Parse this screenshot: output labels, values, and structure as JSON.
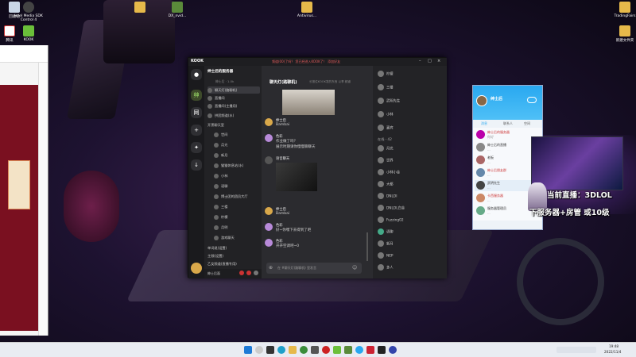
{
  "desktop_icons": [
    {
      "label": "回收站"
    },
    {
      "label": "Intel Media SDK Control 4"
    },
    {
      "label": "DX_nvid..."
    },
    {
      "label": "Antivirus..."
    },
    {
      "label": "TradingFairs"
    },
    {
      "label": "腾讯"
    },
    {
      "label": "KOOK"
    },
    {
      "label": "新建文件夹"
    }
  ],
  "kook": {
    "logo": "KOOK",
    "announcement": "频道(00)了吗？ 您已经进入KOOK了！ 添加好友",
    "server_name": "绅士后的服务器",
    "user_hint": "绅士后 · 1.0k",
    "channels": [
      {
        "label": "聊天灯(路聊机)"
      },
      {
        "label": "直播间"
      },
      {
        "label": "直播间(主播用)"
      },
      {
        "label": "拼团频道(水)"
      },
      {
        "label": "开黑聊天室"
      },
      {
        "label": "世间"
      },
      {
        "label": "月光"
      },
      {
        "label": "新月"
      },
      {
        "label": "猫猫休息站(水)"
      },
      {
        "label": "小林"
      },
      {
        "label": "语聊"
      },
      {
        "label": "博士团的团员大厅"
      },
      {
        "label": "三楼"
      },
      {
        "label": "柠檬"
      },
      {
        "label": "月明"
      },
      {
        "label": "游戏聊天"
      },
      {
        "label": "单词说(设置)"
      },
      {
        "label": "主频(设置)"
      },
      {
        "label": "乙女频道(直播专用)"
      }
    ],
    "footer_user": "绅士后面",
    "chat_title": "聊天灯(路聊机)",
    "chat_subtitle": "长按住KOOK发的东西 以享 频道",
    "messages": [
      {
        "name": "绅士后",
        "text": "Bambai"
      },
      {
        "name": "色彩",
        "text": "作业做了吗？"
      },
      {
        "name": "",
        "text": "展示时期请你慢慢聊聊天"
      },
      {
        "name": "语音聊天",
        "text": ""
      },
      {
        "name": "绅士后",
        "text": "Bambai"
      },
      {
        "name": "色彩",
        "text": "好~你嘿下去得到了吧"
      },
      {
        "name": "色彩",
        "text": "开开空调吧~0"
      }
    ],
    "input_placeholder": "在 #聊天灯(路聊机) 里发言",
    "members_header": "在线 - 42",
    "members": [
      {
        "name": "柠檬"
      },
      {
        "name": "三楼"
      },
      {
        "name": "武明先生"
      },
      {
        "name": "小林"
      },
      {
        "name": "嘉宾"
      },
      {
        "name": "在线 - 42"
      },
      {
        "name": "月光"
      },
      {
        "name": "世界"
      },
      {
        "name": "小林小金"
      },
      {
        "name": "大都"
      },
      {
        "name": "DNLDI"
      },
      {
        "name": "DNLDL白金"
      },
      {
        "name": "Fuzzing02"
      },
      {
        "name": "语聊"
      },
      {
        "name": "新月"
      },
      {
        "name": "NEP"
      },
      {
        "name": "多人"
      }
    ]
  },
  "qq": {
    "user": "绅士后",
    "tabs": [
      "消息",
      "联系人",
      "空间"
    ],
    "chats": [
      {
        "name": "绅士后的服务器",
        "preview": "你好"
      },
      {
        "name": "绅士后的直播",
        "preview": "..."
      },
      {
        "name": "老板",
        "preview": "..."
      },
      {
        "name": "绅士后朋友群",
        "preview": "..."
      },
      {
        "name": "武明先生",
        "preview": "..."
      },
      {
        "name": "卡西服务器",
        "preview": "..."
      },
      {
        "name": "服务器管理员",
        "preview": "..."
      }
    ]
  },
  "overlay": {
    "line1": "当前直播：3DLOL",
    "line2": "下服务器+房管   或10级"
  },
  "taskbar": {
    "time": "19:48",
    "date": "2022/11/4"
  }
}
